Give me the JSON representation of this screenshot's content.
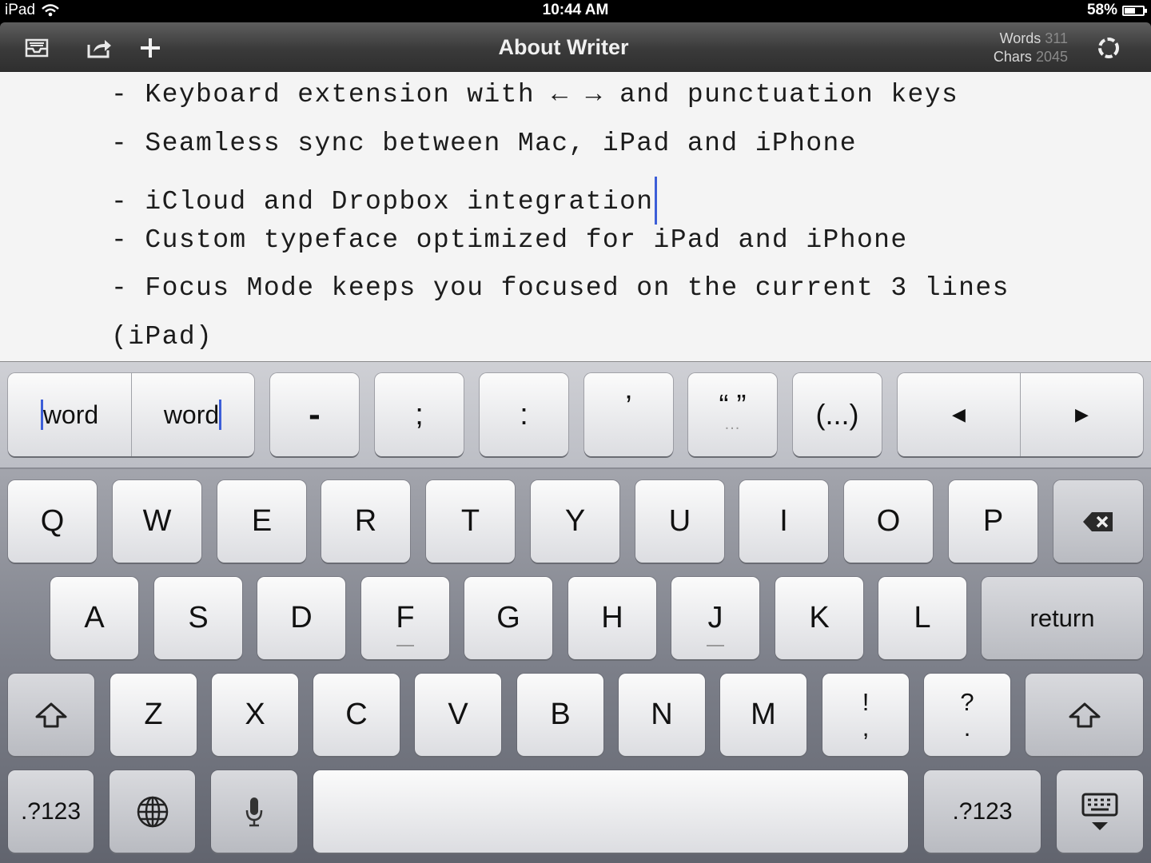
{
  "status_bar": {
    "device": "iPad",
    "time": "10:44 AM",
    "battery": "58%",
    "battery_level": 0.58
  },
  "toolbar": {
    "title": "About Writer",
    "words_label": "Words",
    "words_value": "311",
    "chars_label": "Chars",
    "chars_value": "2045"
  },
  "editor": {
    "lines": [
      "- Keyboard extension with ← → and punctuation keys",
      "- Seamless sync between Mac, iPad and iPhone",
      "- iCloud and Dropbox integration",
      "- Custom typeface optimized for iPad and iPhone",
      "- Focus Mode keeps you focused on the current 3 lines",
      "(iPad)"
    ]
  },
  "extension_row": {
    "word_left": "word",
    "word_right": "word",
    "dash": "-",
    "semicolon": ";",
    "colon": ":",
    "apostrophe": "’",
    "quotes": "“ ”",
    "parens": "(...)",
    "quotes_dots": "...",
    "parens_dots": "...",
    "left_arrow": "◀",
    "right_arrow": "▶"
  },
  "keys": {
    "row1": [
      "Q",
      "W",
      "E",
      "R",
      "T",
      "Y",
      "U",
      "I",
      "O",
      "P"
    ],
    "row2": [
      "A",
      "S",
      "D",
      "F",
      "G",
      "H",
      "J",
      "K",
      "L"
    ],
    "row3": [
      "Z",
      "X",
      "C",
      "V",
      "B",
      "N",
      "M"
    ],
    "return": "return",
    "excl_top": "!",
    "excl_bottom": ",",
    "ques_top": "?",
    "ques_bottom": ".",
    "numbers_left": ".?123",
    "numbers_right": ".?123"
  },
  "colors": {
    "accent_caret": "#3c5ed8",
    "toolbar": "#3a3a3a",
    "editor_bg": "#f4f4f4"
  },
  "icons": [
    "wifi-icon",
    "battery-icon",
    "inbox-icon",
    "share-icon",
    "plus-icon",
    "sync-icon",
    "backspace-icon",
    "shift-icon",
    "globe-icon",
    "microphone-icon",
    "keyboard-dismiss-icon"
  ]
}
